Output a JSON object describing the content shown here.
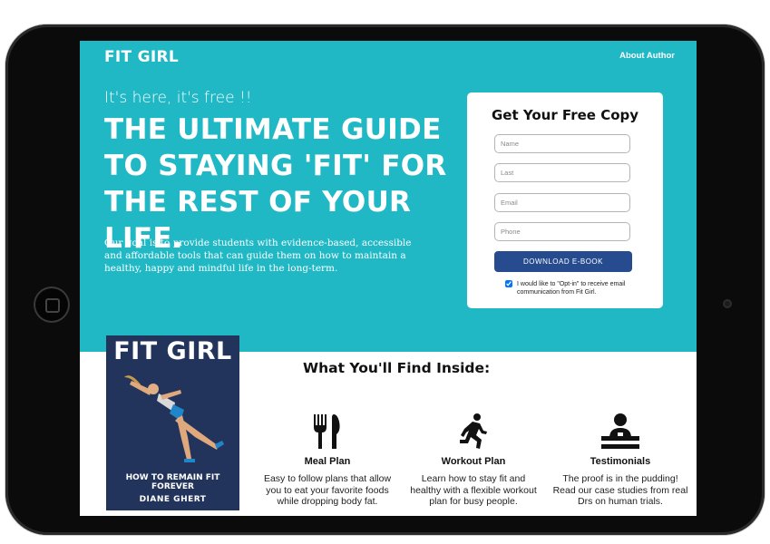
{
  "brand": "FIT GIRL",
  "nav": {
    "about_label": "About Author"
  },
  "hero": {
    "tagline": "It's here, it's free !!",
    "headline": "THE ULTIMATE GUIDE TO STAYING 'FIT' FOR THE REST OF YOUR LIFE.",
    "description": "Our goal is to provide students with evidence-based, accessible and affordable tools that can guide them on how to maintain a healthy, happy and mindful life in the long-term."
  },
  "form": {
    "title": "Get Your Free Copy",
    "fields": [
      {
        "placeholder": "Name",
        "value": ""
      },
      {
        "placeholder": "Last",
        "value": ""
      },
      {
        "placeholder": "Email",
        "value": ""
      },
      {
        "placeholder": "Phone",
        "value": ""
      }
    ],
    "submit_label": "DOWNLOAD  E-BOOK",
    "optin_checked": true,
    "optin_label": "I would like to \"Opt-in\" to receive email communication from Fit Girl."
  },
  "book": {
    "title": "FIT GIRL",
    "subtitle": "HOW TO REMAIN FIT FOREVER",
    "author": "DIANE GHERT"
  },
  "inside": {
    "title": "What You'll Find Inside:",
    "features": [
      {
        "icon": "fork-knife-icon",
        "name": "Meal Plan",
        "description": "Easy to follow plans that allow you to eat your favorite foods while dropping body fat."
      },
      {
        "icon": "runner-icon",
        "name": "Workout Plan",
        "description": "Learn how to stay fit and healthy with a flexible workout plan for busy people."
      },
      {
        "icon": "speaker-podium-icon",
        "name": "Testimonials",
        "description": "The proof is in the pudding! Read our case studies from real Drs on human trials."
      }
    ]
  },
  "colors": {
    "hero_bg": "#21b8c5",
    "button_bg": "#274b8f",
    "book_bg": "#23345c",
    "device_frame": "#0b0b0b"
  }
}
